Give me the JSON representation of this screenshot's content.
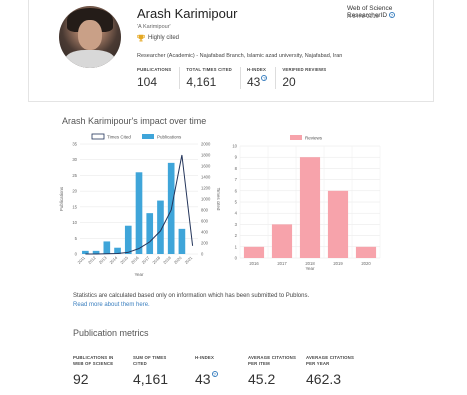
{
  "profile": {
    "name": "Arash Karimipour",
    "alias": "'A Karimipour'",
    "highly_cited": "Highly cited",
    "affiliation": "Researcher (Academic) - Najafabad Branch, Islamic azad university, Najafabad, Iran",
    "wos_label": "Web of Science ResearcherID",
    "wos_id": "A-3478-2019",
    "help_glyph": "?"
  },
  "summary_metrics": [
    {
      "label": "PUBLICATIONS",
      "value": "104"
    },
    {
      "label": "TOTAL TIMES CITED",
      "value": "4,161"
    },
    {
      "label": "H-INDEX",
      "value": "43"
    },
    {
      "label": "VERIFIED REVIEWS",
      "value": "20"
    }
  ],
  "impact": {
    "title": "Arash Karimipour's impact over time"
  },
  "colors": {
    "bar": "#3fa5d9",
    "line": "#23345a",
    "review_bar": "#f7a3ab",
    "link": "#3a7fbf"
  },
  "chart_data": [
    {
      "type": "bar",
      "legend": [
        "Times Cited",
        "Publications"
      ],
      "categories": [
        "2011",
        "2012",
        "2013",
        "2014",
        "2015",
        "2016",
        "2017",
        "2018",
        "2019",
        "2020",
        "2021"
      ],
      "series": [
        {
          "name": "Publications",
          "values": [
            1,
            1,
            4,
            2,
            9,
            26,
            13,
            17,
            29,
            8,
            0
          ]
        },
        {
          "name": "Times Cited",
          "values": [
            0,
            0,
            5,
            10,
            30,
            100,
            220,
            420,
            800,
            1800,
            150
          ]
        }
      ],
      "xlabel": "Year",
      "ylabel": "Publications",
      "y2label": "Times cited",
      "ylim": [
        0,
        35
      ],
      "yticks": [
        0,
        5,
        10,
        15,
        20,
        25,
        30,
        35
      ],
      "y2lim": [
        0,
        2000
      ],
      "y2ticks": [
        0,
        200,
        400,
        600,
        800,
        1000,
        1200,
        1400,
        1600,
        1800,
        2000
      ],
      "grid": true
    },
    {
      "type": "bar",
      "legend": [
        "Reviews"
      ],
      "categories": [
        "2016",
        "2017",
        "2018",
        "2019",
        "2020"
      ],
      "series": [
        {
          "name": "Reviews",
          "values": [
            1,
            3,
            9,
            6,
            1
          ]
        }
      ],
      "xlabel": "Year",
      "ylim": [
        0,
        10
      ],
      "yticks": [
        0,
        1,
        2,
        3,
        4,
        5,
        6,
        7,
        8,
        9,
        10
      ],
      "grid": true
    }
  ],
  "notes": {
    "stats": "Statistics are calculated based only on information which has been submitted to Publons.",
    "read_more": "Read more about them here."
  },
  "publication_metrics": {
    "title": "Publication metrics",
    "items": [
      {
        "label_lines": [
          "PUBLICATIONS IN",
          "WEB OF SCIENCE"
        ],
        "value": "92"
      },
      {
        "label_lines": [
          "SUM OF TIMES",
          "CITED"
        ],
        "value": "4,161"
      },
      {
        "label_lines": [
          "H-INDEX",
          ""
        ],
        "value": "43"
      },
      {
        "label_lines": [
          "AVERAGE CITATIONS",
          "PER ITEM"
        ],
        "value": "45.2"
      },
      {
        "label_lines": [
          "AVERAGE CITATIONS",
          "PER YEAR"
        ],
        "value": "462.3"
      }
    ]
  }
}
